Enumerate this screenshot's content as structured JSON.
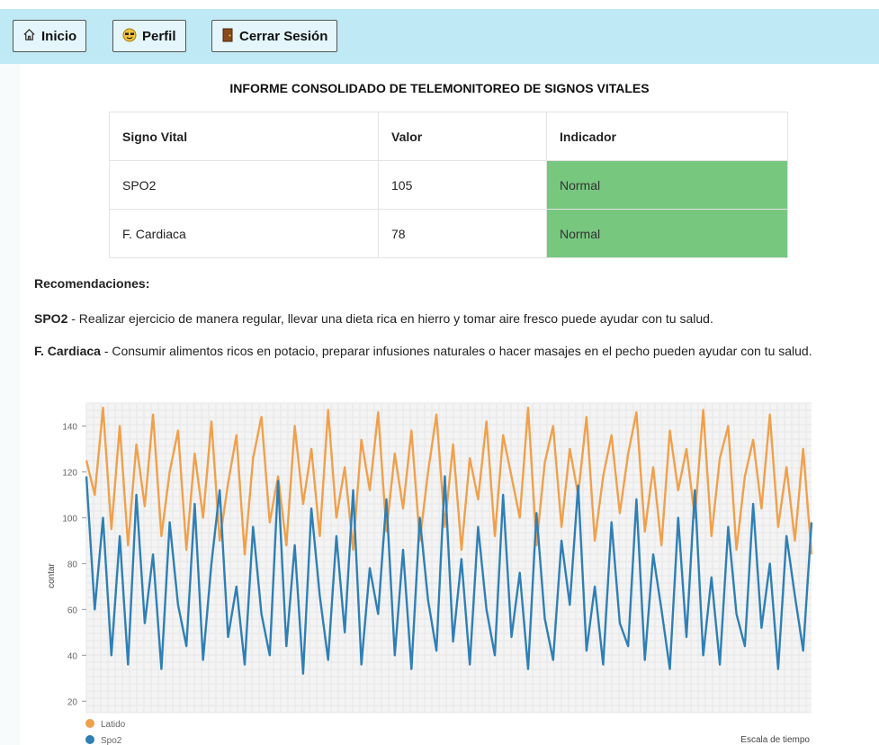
{
  "nav": {
    "home": {
      "label": "Inicio",
      "icon": "home-icon"
    },
    "profile": {
      "label": "Perfil",
      "icon": "smiley-icon"
    },
    "logout": {
      "label": "Cerrar Sesión",
      "icon": "door-icon"
    }
  },
  "report": {
    "title": "INFORME CONSOLIDADO DE TELEMONITOREO DE SIGNOS VITALES",
    "columns": [
      "Signo Vital",
      "Valor",
      "Indicador"
    ],
    "rows": [
      {
        "sign": "SPO2",
        "value": "105",
        "indicator": "Normal"
      },
      {
        "sign": "F. Cardiaca",
        "value": "78",
        "indicator": "Normal"
      }
    ],
    "indicator_color": "#77c77f"
  },
  "recommendations": {
    "title": "Recomendaciones:",
    "items": [
      {
        "label": "SPO2",
        "text": " - Realizar ejercicio de manera regular, llevar una dieta rica en hierro y tomar aire fresco puede ayudar con tu salud."
      },
      {
        "label": "F. Cardiaca",
        "text": " - Consumir alimentos ricos en potacio, preparar infusiones naturales o hacer masajes en el pecho pueden ayudar con tu salud."
      }
    ]
  },
  "chart_data": {
    "type": "line",
    "xlabel": "Escala de tiempo",
    "ylabel": "contar",
    "yticks": [
      20,
      40,
      60,
      80,
      100,
      120,
      140
    ],
    "ylim": [
      15,
      150
    ],
    "grid": true,
    "legend_position": "bottom-left",
    "series": [
      {
        "name": "Latido",
        "color": "#f0a04b",
        "values": [
          125,
          110,
          148,
          95,
          140,
          88,
          132,
          105,
          145,
          92,
          120,
          138,
          86,
          128,
          100,
          142,
          90,
          115,
          136,
          84,
          126,
          144,
          98,
          118,
          88,
          140,
          106,
          130,
          92,
          147,
          100,
          122,
          86,
          134,
          112,
          146,
          94,
          128,
          104,
          138,
          90,
          120,
          145,
          96,
          132,
          86,
          126,
          108,
          142,
          92,
          136,
          118,
          100,
          148,
          88,
          124,
          140,
          96,
          130,
          110,
          144,
          90,
          118,
          136,
          102,
          128,
          146,
          94,
          122,
          88,
          138,
          112,
          130,
          100,
          147,
          92,
          126,
          140,
          86,
          118,
          134,
          104,
          145,
          96,
          122,
          90,
          130,
          84
        ]
      },
      {
        "name": "Spo2",
        "color": "#2f7fb5",
        "values": [
          118,
          60,
          100,
          40,
          92,
          36,
          110,
          54,
          84,
          34,
          98,
          62,
          44,
          106,
          38,
          80,
          112,
          48,
          70,
          36,
          96,
          58,
          40,
          116,
          44,
          88,
          32,
          104,
          66,
          38,
          92,
          50,
          112,
          36,
          78,
          58,
          108,
          40,
          86,
          34,
          100,
          64,
          42,
          118,
          46,
          82,
          36,
          96,
          60,
          40,
          110,
          48,
          76,
          34,
          102,
          56,
          38,
          90,
          62,
          114,
          42,
          70,
          36,
          98,
          54,
          44,
          108,
          38,
          84,
          60,
          34,
          100,
          48,
          112,
          40,
          74,
          36,
          96,
          58,
          44,
          106,
          52,
          80,
          34,
          92,
          66,
          42,
          98
        ]
      }
    ]
  }
}
